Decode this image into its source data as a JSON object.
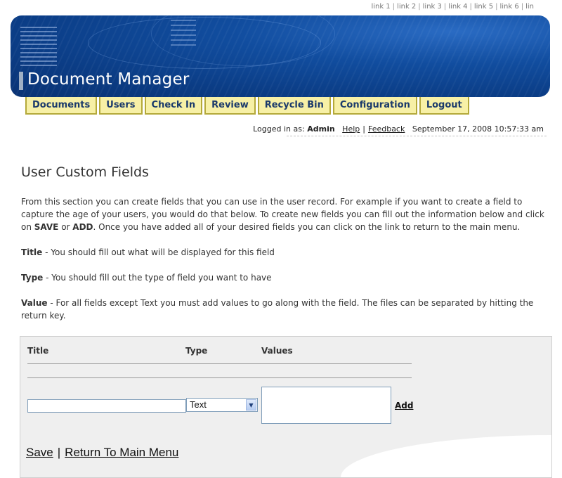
{
  "top_links": [
    "link 1",
    "link 2",
    "link 3",
    "link 4",
    "link 5",
    "link 6",
    "lin"
  ],
  "header": {
    "title": "Document Manager"
  },
  "nav": {
    "tabs": [
      "Documents",
      "Users",
      "Check In",
      "Review",
      "Recycle Bin",
      "Configuration",
      "Logout"
    ]
  },
  "status": {
    "logged_in_label": "Logged in as:",
    "user": "Admin",
    "help": "Help",
    "feedback": "Feedback",
    "datetime": "September 17, 2008 10:57:33 am"
  },
  "page": {
    "title": "User Custom Fields",
    "intro_1": "From this section you can create fields that you can use in the user record. For example if you want to create a field to capture the age of your users, you would do that below. To create new fields you can fill out the information below and click on ",
    "intro_save": "SAVE",
    "intro_or": " or ",
    "intro_add": "ADD",
    "intro_2": ". Once you have added all of your desired fields you can click on the link to return to the main menu.",
    "title_term": "Title",
    "title_desc": " - You should fill out what will be displayed for this field",
    "type_term": "Type",
    "type_desc": " - You should fill out the type of field you want to have",
    "value_term": "Value",
    "value_desc": " - For all fields except Text you must add values to go along with the field. The files can be separated by hitting the return key."
  },
  "form": {
    "col_title": "Title",
    "col_type": "Type",
    "col_values": "Values",
    "title_value": "",
    "type_selected": "Text",
    "values_value": "",
    "add_label": "Add"
  },
  "footer": {
    "save": "Save",
    "separator": "|",
    "return": "Return To Main Menu"
  },
  "colors": {
    "banner": "#0b3d86",
    "tab_bg": "#f7f0a6",
    "tab_border": "#b4a93a",
    "tab_text": "#1b3a6b",
    "panel_bg": "#efefef"
  }
}
